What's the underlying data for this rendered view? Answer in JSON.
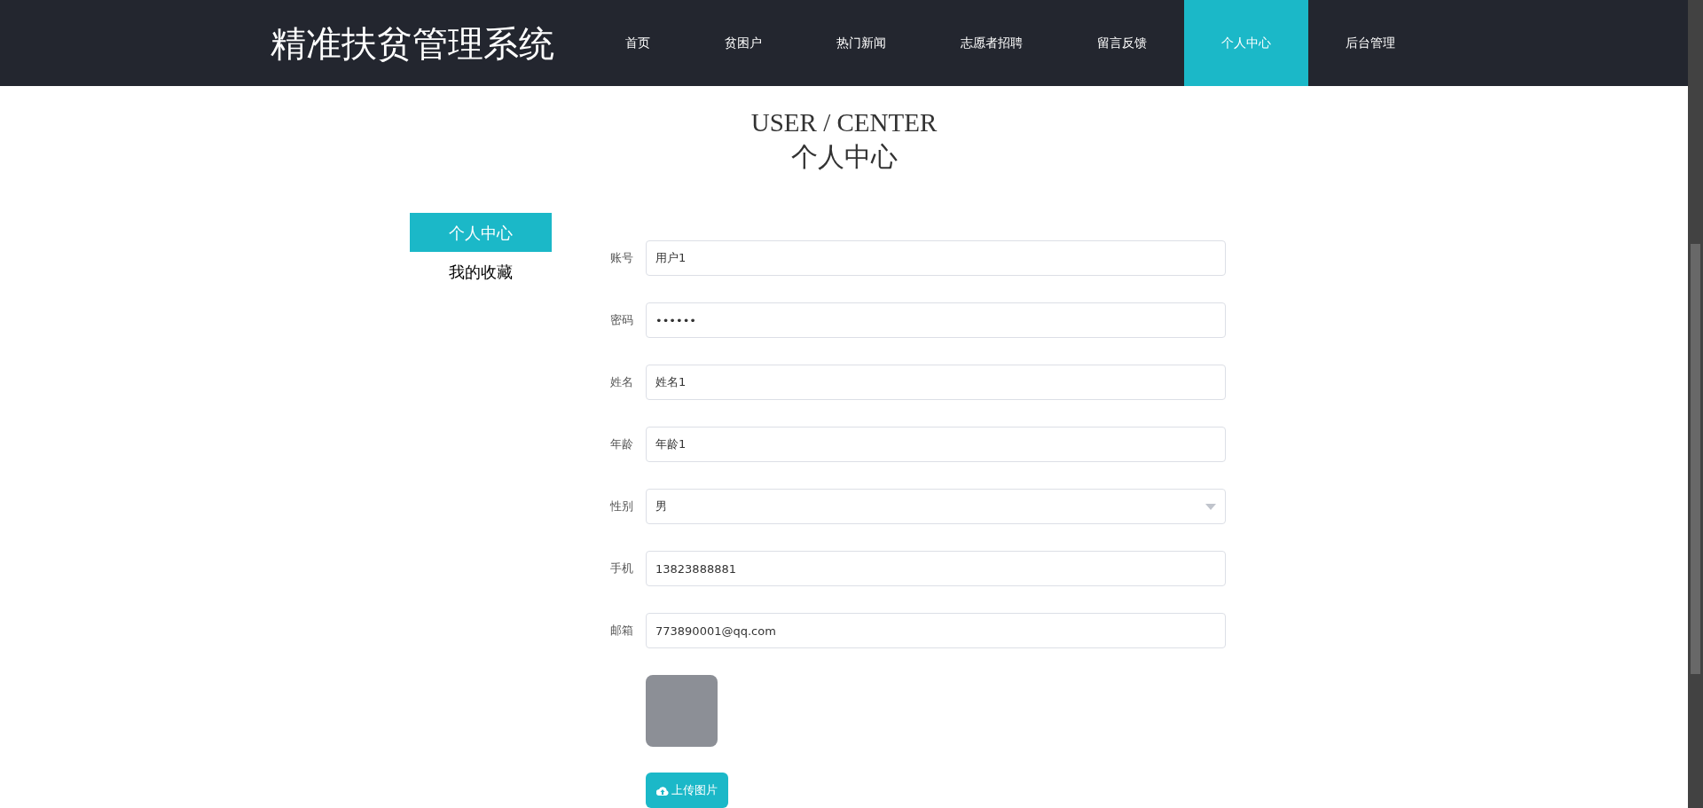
{
  "header": {
    "title": "精准扶贫管理系统",
    "nav": [
      {
        "label": "首页",
        "selected": false
      },
      {
        "label": "贫困户",
        "selected": false
      },
      {
        "label": "热门新闻",
        "selected": false
      },
      {
        "label": "志愿者招聘",
        "selected": false
      },
      {
        "label": "留言反馈",
        "selected": false
      },
      {
        "label": "个人中心",
        "selected": true
      },
      {
        "label": "后台管理",
        "selected": false
      }
    ]
  },
  "heading": {
    "english": "USER / CENTER",
    "chinese": "个人中心"
  },
  "sidebar": {
    "items": [
      {
        "label": "个人中心",
        "selected": true
      },
      {
        "label": "我的收藏",
        "selected": false
      }
    ]
  },
  "form": {
    "fields": [
      {
        "kind": "text",
        "label": "账号",
        "value": "用户1"
      },
      {
        "kind": "password",
        "label": "密码",
        "value": "••••••"
      },
      {
        "kind": "text",
        "label": "姓名",
        "value": "姓名1"
      },
      {
        "kind": "text",
        "label": "年龄",
        "value": "年龄1"
      },
      {
        "kind": "select",
        "label": "性别",
        "value": "男"
      },
      {
        "kind": "text",
        "label": "手机",
        "value": "13823888881"
      },
      {
        "kind": "text",
        "label": "邮箱",
        "value": "773890001@qq.com"
      }
    ],
    "upload_button": "上传图片"
  }
}
